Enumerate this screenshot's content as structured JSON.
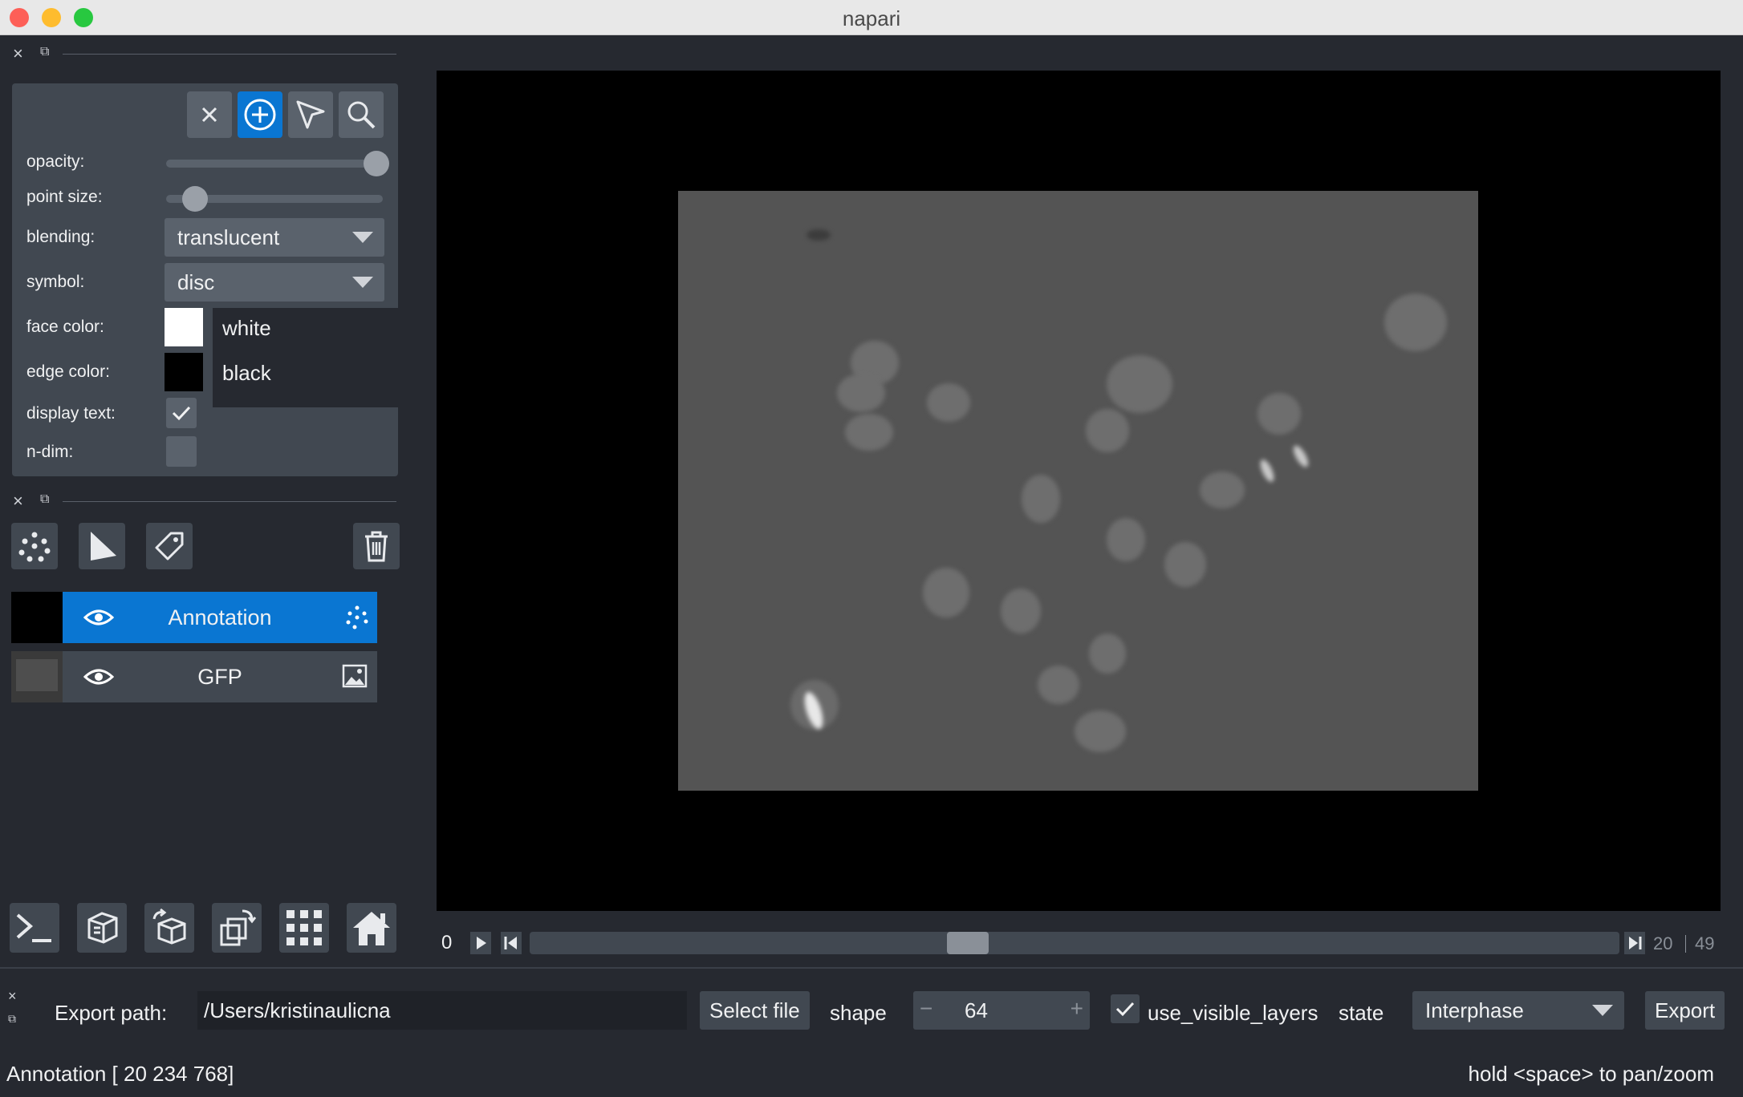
{
  "window": {
    "title": "napari"
  },
  "controls": {
    "modes": [
      "delete-selected",
      "add-points",
      "select-points",
      "pan-zoom"
    ],
    "opacity_label": "opacity:",
    "opacity_value": 1.0,
    "point_size_label": "point size:",
    "point_size_value": 0.15,
    "blending_label": "blending:",
    "blending_value": "translucent",
    "symbol_label": "symbol:",
    "symbol_value": "disc",
    "face_color_label": "face color:",
    "face_color_name": "white",
    "face_color_hex": "#ffffff",
    "edge_color_label": "edge color:",
    "edge_color_name": "black",
    "edge_color_hex": "#000000",
    "display_text_label": "display text:",
    "display_text_checked": true,
    "ndim_label": "n-dim:",
    "ndim_checked": false
  },
  "layers": [
    {
      "name": "Annotation",
      "type": "points",
      "visible": true,
      "selected": true
    },
    {
      "name": "GFP",
      "type": "image",
      "visible": true,
      "selected": false
    }
  ],
  "layer_buttons": [
    "new-points-layer",
    "new-shapes-layer",
    "new-labels-layer",
    "delete-layer"
  ],
  "bottom_buttons": [
    "console",
    "toggle-ndisplay",
    "roll-dims",
    "transpose-dims",
    "grid-view",
    "reset-view"
  ],
  "dims": {
    "index": "0",
    "current": "20",
    "max": "49",
    "slider_fraction": 0.41
  },
  "widget": {
    "export_label": "Export path:",
    "export_value": "/Users/kristinaulicna",
    "select_file": "Select file",
    "shape_label": "shape",
    "shape_value": "64",
    "minus": "−",
    "plus": "+",
    "use_visible_layers_label": "use_visible_layers",
    "use_visible_layers_checked": true,
    "state_label": "state",
    "state_value": "Interphase",
    "export_button": "Export"
  },
  "status": {
    "left": "Annotation [ 20 234 768]",
    "right": "hold <space> to pan/zoom"
  },
  "colors": {
    "accent": "#0a76d2",
    "background": "#262930",
    "panel": "#414851"
  }
}
